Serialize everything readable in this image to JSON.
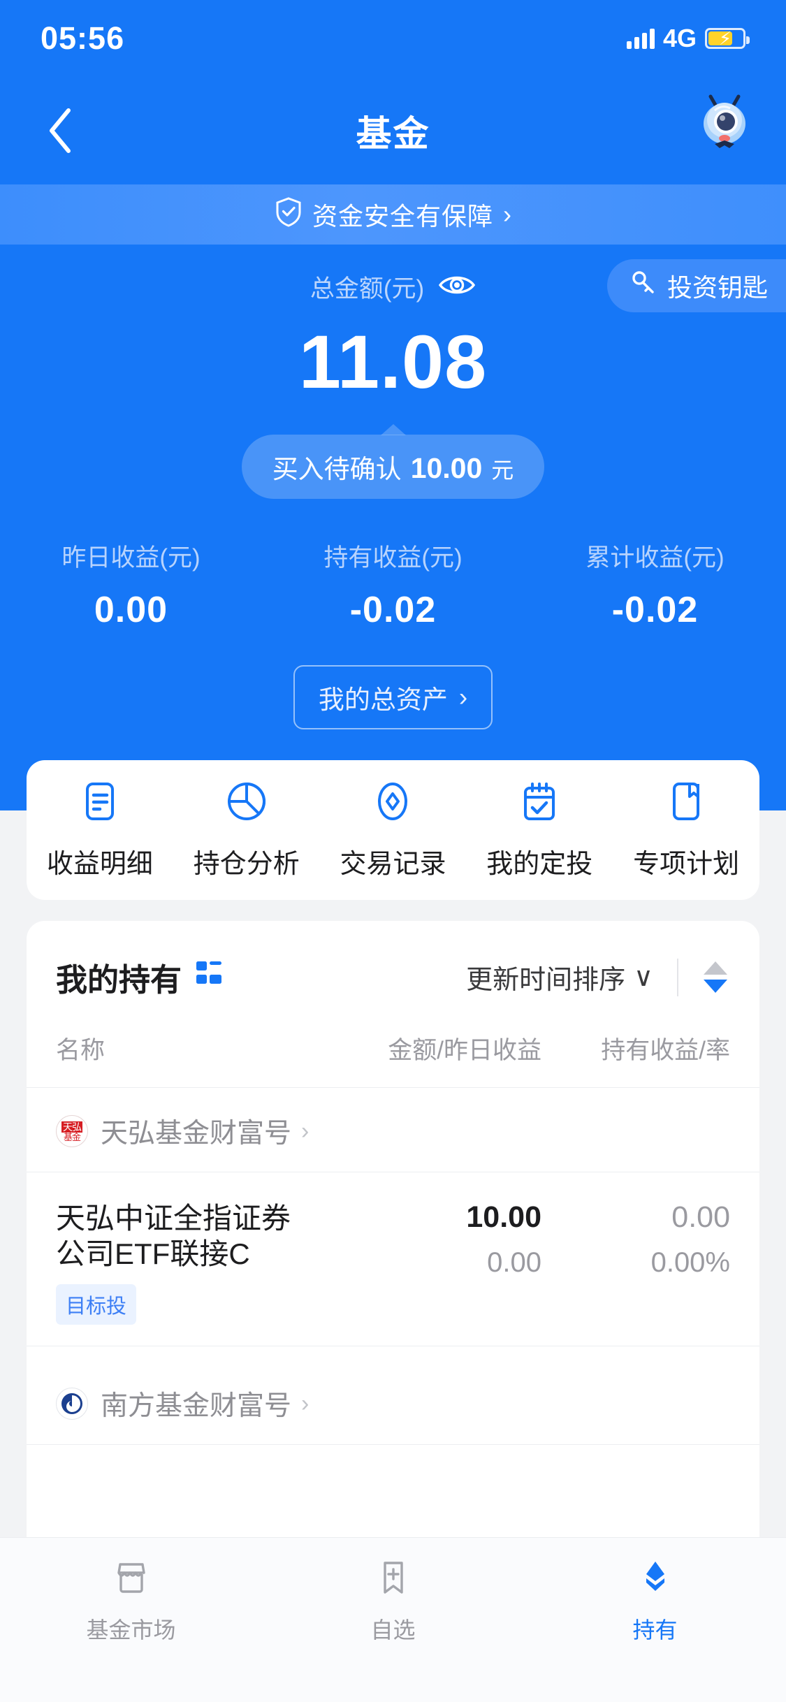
{
  "status_bar": {
    "time": "05:56",
    "network": "4G",
    "signal_icon": "signal-bars-icon",
    "battery_icon": "battery-charging-icon"
  },
  "nav": {
    "back_icon": "back-chevron-icon",
    "title": "基金",
    "avatar_icon": "mascot-avatar-icon"
  },
  "safety_banner": {
    "icon": "shield-check-icon",
    "text": "资金安全有保障",
    "chevron": "›"
  },
  "summary": {
    "total_label": "总金额(元)",
    "eye_icon": "eye-visible-icon",
    "invest_key": {
      "icon": "key-icon",
      "label": "投资钥匙"
    },
    "total_amount": "11.08",
    "pending": {
      "label": "买入待确认",
      "value": "10.00",
      "unit": "元"
    },
    "stats": [
      {
        "label": "昨日收益(元)",
        "value": "0.00"
      },
      {
        "label": "持有收益(元)",
        "value": "-0.02"
      },
      {
        "label": "累计收益(元)",
        "value": "-0.02"
      }
    ],
    "assets_button": {
      "label": "我的总资产",
      "chevron": "›"
    }
  },
  "quick_actions": [
    {
      "icon": "document-list-icon",
      "label": "收益明细"
    },
    {
      "icon": "pie-chart-icon",
      "label": "持仓分析"
    },
    {
      "icon": "diamond-circle-icon",
      "label": "交易记录"
    },
    {
      "icon": "calendar-check-icon",
      "label": "我的定投"
    },
    {
      "icon": "bookmark-icon",
      "label": "专项计划"
    }
  ],
  "holdings": {
    "title": "我的持有",
    "title_icon": "grid-layout-icon",
    "sort": {
      "label": "更新时间排序",
      "chevron": "∨"
    },
    "sort_arrows_icon": "sort-arrows-icon",
    "columns": [
      "名称",
      "金额/昨日收益",
      "持有收益/率"
    ],
    "groups": [
      {
        "logo": "tianhong-fund-logo",
        "logo_line1": "天弘",
        "logo_line2": "基金",
        "name": "天弘基金财富号",
        "chevron": "›",
        "funds": [
          {
            "name": "天弘中证全指证券公司ETF联接C",
            "badge": "目标投",
            "amount": "10.00",
            "yesterday_profit": "0.00",
            "hold_profit": "0.00",
            "hold_rate": "0.00%"
          }
        ]
      },
      {
        "logo": "nanfang-fund-logo",
        "name": "南方基金财富号",
        "chevron": "›",
        "funds": []
      }
    ]
  },
  "tabbar": [
    {
      "icon": "shop-market-icon",
      "label": "基金市场",
      "active": false
    },
    {
      "icon": "bookmark-plus-icon",
      "label": "自选",
      "active": false
    },
    {
      "icon": "layers-holding-icon",
      "label": "持有",
      "active": true
    }
  ],
  "colors": {
    "brand_blue": "#1677f7",
    "banner_blue": "#4d96fd",
    "active_tab": "#1677f7",
    "badge_text": "#3d7ff5",
    "badge_bg": "#eaf2ff",
    "muted_text": "#9a9aa0"
  }
}
